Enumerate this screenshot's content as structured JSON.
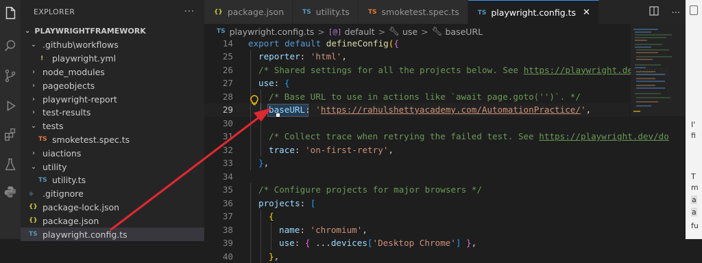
{
  "explorer": {
    "title": "EXPLORER",
    "more": "···",
    "root": "PLAYWRIGHTFRAMEWORK",
    "items": [
      {
        "label": ".github\\workflows",
        "type": "folder-open",
        "depth": 1
      },
      {
        "label": "playwright.yml",
        "type": "yml",
        "depth": 2
      },
      {
        "label": "node_modules",
        "type": "folder",
        "depth": 1
      },
      {
        "label": "pageobjects",
        "type": "folder",
        "depth": 1
      },
      {
        "label": "playwright-report",
        "type": "folder",
        "depth": 1
      },
      {
        "label": "test-results",
        "type": "folder",
        "depth": 1
      },
      {
        "label": "tests",
        "type": "folder-open",
        "depth": 1
      },
      {
        "label": "smoketest.spec.ts",
        "type": "ts-red",
        "depth": 2
      },
      {
        "label": "uiactions",
        "type": "folder",
        "depth": 1
      },
      {
        "label": "utility",
        "type": "folder-open",
        "depth": 1
      },
      {
        "label": "utility.ts",
        "type": "ts",
        "depth": 2
      },
      {
        "label": ".gitignore",
        "type": "git",
        "depth": 1
      },
      {
        "label": "package-lock.json",
        "type": "json",
        "depth": 1
      },
      {
        "label": "package.json",
        "type": "json",
        "depth": 1
      },
      {
        "label": "playwright.config.ts",
        "type": "ts",
        "depth": 1,
        "selected": true
      }
    ]
  },
  "tabs": [
    {
      "label": "package.json",
      "icon": "{}",
      "type": "json"
    },
    {
      "label": "utility.ts",
      "icon": "TS",
      "type": "ts"
    },
    {
      "label": "smoketest.spec.ts",
      "icon": "TS",
      "type": "ts-red"
    },
    {
      "label": "playwright.config.ts",
      "icon": "TS",
      "type": "ts",
      "active": true,
      "close": "✕"
    }
  ],
  "breadcrumb": {
    "file_icon": "TS",
    "file": "playwright.config.ts",
    "sep": ">",
    "items": [
      "default",
      "use",
      "baseURL"
    ]
  },
  "right_pane": {
    "chars": [
      "I'",
      "fi",
      "T",
      "m",
      "a",
      "a",
      "fu"
    ]
  },
  "colors": {
    "accent": "#3794ff",
    "arrow": "#e0282f",
    "editor_bg": "#1e1e1e",
    "sidebar_bg": "#252526"
  },
  "code": [
    {
      "n": "14",
      "t": [
        [
          "kw",
          "export "
        ],
        [
          "kw",
          "default "
        ],
        [
          "fn",
          "defineConfig"
        ],
        [
          "brk",
          "("
        ],
        [
          "brk2",
          "{"
        ]
      ]
    },
    {
      "n": "25",
      "indent": 1,
      "t": [
        [
          "prop",
          "reporter"
        ],
        [
          "punc",
          ": "
        ],
        [
          "str",
          "'html'"
        ],
        [
          "punc",
          ","
        ]
      ]
    },
    {
      "n": "26",
      "indent": 1,
      "t": [
        [
          "cm",
          "/* Shared settings for all the projects below. See "
        ],
        [
          "cm url",
          "https://playwright.dev/docs/"
        ]
      ]
    },
    {
      "n": "27",
      "indent": 1,
      "t": [
        [
          "prop",
          "use"
        ],
        [
          "punc",
          ": "
        ],
        [
          "brk3",
          "{"
        ]
      ]
    },
    {
      "n": "28",
      "indent": 2,
      "t": [
        [
          "cm",
          "/* Base URL to use in actions like `await page.goto('')`. */"
        ]
      ]
    },
    {
      "n": "29",
      "indent": 2,
      "cur": true,
      "t": [
        [
          "prop",
          "baseURL"
        ],
        [
          "punc",
          ": "
        ],
        [
          "str",
          "'"
        ],
        [
          "str url",
          "https://rahulshettyacademy.com/AutomationPractice/"
        ],
        [
          "str",
          "'"
        ],
        [
          "punc",
          ","
        ]
      ]
    },
    {
      "n": "30",
      "indent": 2,
      "t": []
    },
    {
      "n": "31",
      "indent": 2,
      "t": [
        [
          "cm",
          "/* Collect trace when retrying the failed test. See "
        ],
        [
          "cm url",
          "https://playwright.dev/do"
        ]
      ]
    },
    {
      "n": "32",
      "indent": 2,
      "t": [
        [
          "prop",
          "trace"
        ],
        [
          "punc",
          ": "
        ],
        [
          "str",
          "'on-first-retry'"
        ],
        [
          "punc",
          ","
        ]
      ]
    },
    {
      "n": "33",
      "indent": 1,
      "t": [
        [
          "brk3",
          "}"
        ],
        [
          "punc",
          ","
        ]
      ]
    },
    {
      "n": "34",
      "indent": 0,
      "t": []
    },
    {
      "n": "35",
      "indent": 1,
      "t": [
        [
          "cm",
          "/* Configure projects for major browsers */"
        ]
      ]
    },
    {
      "n": "36",
      "indent": 1,
      "t": [
        [
          "prop",
          "projects"
        ],
        [
          "punc",
          ": "
        ],
        [
          "brk3",
          "["
        ]
      ]
    },
    {
      "n": "37",
      "indent": 2,
      "t": [
        [
          "brk",
          "{"
        ]
      ]
    },
    {
      "n": "38",
      "indent": 3,
      "t": [
        [
          "prop",
          "name"
        ],
        [
          "punc",
          ": "
        ],
        [
          "str",
          "'chromium'"
        ],
        [
          "punc",
          ","
        ]
      ]
    },
    {
      "n": "39",
      "indent": 3,
      "t": [
        [
          "prop",
          "use"
        ],
        [
          "punc",
          ": "
        ],
        [
          "brk2",
          "{ "
        ],
        [
          "punc",
          "..."
        ],
        [
          "prop",
          "devices"
        ],
        [
          "brk3",
          "["
        ],
        [
          "str",
          "'Desktop Chrome'"
        ],
        [
          "brk3",
          "]"
        ],
        [
          "brk2",
          " }"
        ],
        [
          "punc",
          ","
        ]
      ]
    },
    {
      "n": "40",
      "indent": 2,
      "t": [
        [
          "brk",
          "}"
        ],
        [
          "punc",
          ","
        ]
      ]
    }
  ]
}
